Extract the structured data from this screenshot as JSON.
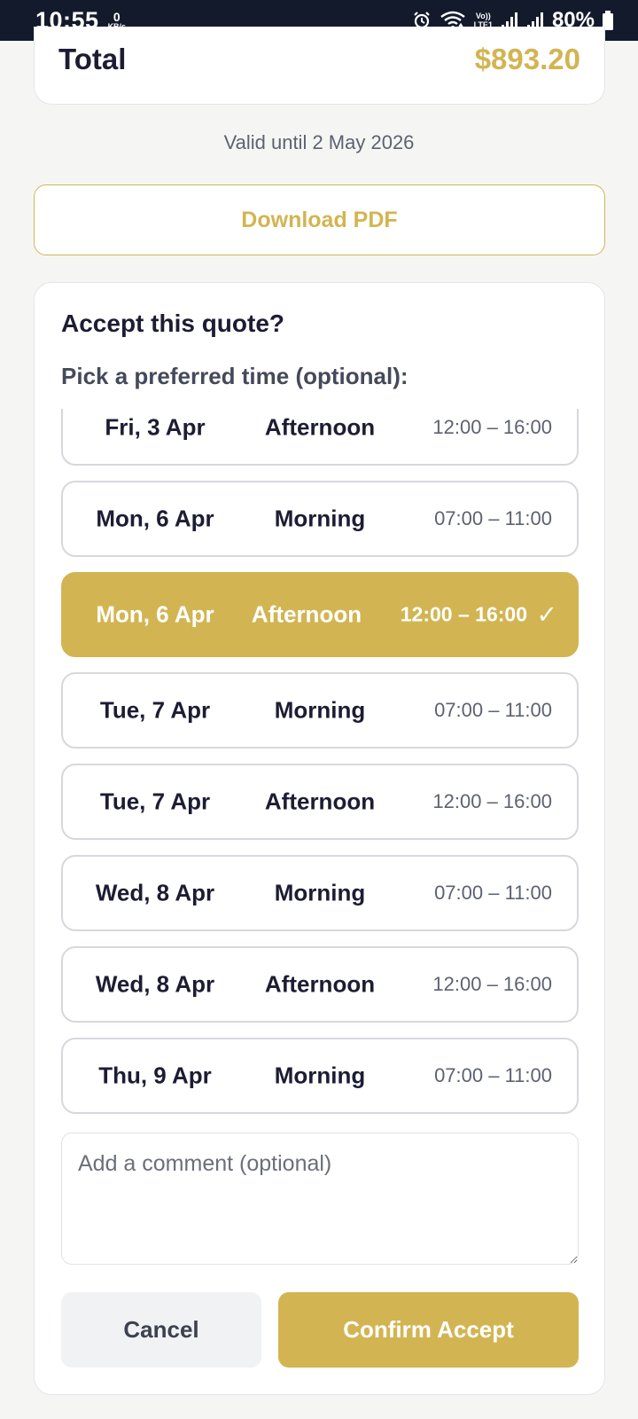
{
  "status_bar": {
    "time": "10:55",
    "net_speed_value": "0",
    "net_speed_unit": "KB/s",
    "volte_top": "Vo))",
    "volte_bottom": "LTE1",
    "battery": "80%"
  },
  "summary": {
    "total_label": "Total",
    "total_value": "$893.20",
    "valid_until": "Valid until 2 May 2026",
    "download_label": "Download PDF"
  },
  "accept": {
    "title": "Accept this quote?",
    "subtitle": "Pick a preferred time (optional):",
    "slots": [
      {
        "day": "Fri, 3 Apr",
        "period": "Afternoon",
        "time": "12:00 – 16:00",
        "selected": false
      },
      {
        "day": "Mon, 6 Apr",
        "period": "Morning",
        "time": "07:00 – 11:00",
        "selected": false
      },
      {
        "day": "Mon, 6 Apr",
        "period": "Afternoon",
        "time": "12:00 – 16:00",
        "selected": true
      },
      {
        "day": "Tue, 7 Apr",
        "period": "Morning",
        "time": "07:00 – 11:00",
        "selected": false
      },
      {
        "day": "Tue, 7 Apr",
        "period": "Afternoon",
        "time": "12:00 – 16:00",
        "selected": false
      },
      {
        "day": "Wed, 8 Apr",
        "period": "Morning",
        "time": "07:00 – 11:00",
        "selected": false
      },
      {
        "day": "Wed, 8 Apr",
        "period": "Afternoon",
        "time": "12:00 – 16:00",
        "selected": false
      },
      {
        "day": "Thu, 9 Apr",
        "period": "Morning",
        "time": "07:00 – 11:00",
        "selected": false
      }
    ],
    "selected_mark": "✓",
    "comment_placeholder": "Add a comment (optional)",
    "comment_value": "",
    "cancel_label": "Cancel",
    "confirm_label": "Confirm Accept"
  },
  "colors": {
    "accent": "#d2b552",
    "status_bar_bg": "#121a2c",
    "page_bg": "#f5f6f4",
    "text_dark": "#1c1d33",
    "text_muted": "#5d6271"
  },
  "icons": [
    "alarm-icon",
    "wifi-icon",
    "signal-icon",
    "battery-icon",
    "check-icon"
  ]
}
